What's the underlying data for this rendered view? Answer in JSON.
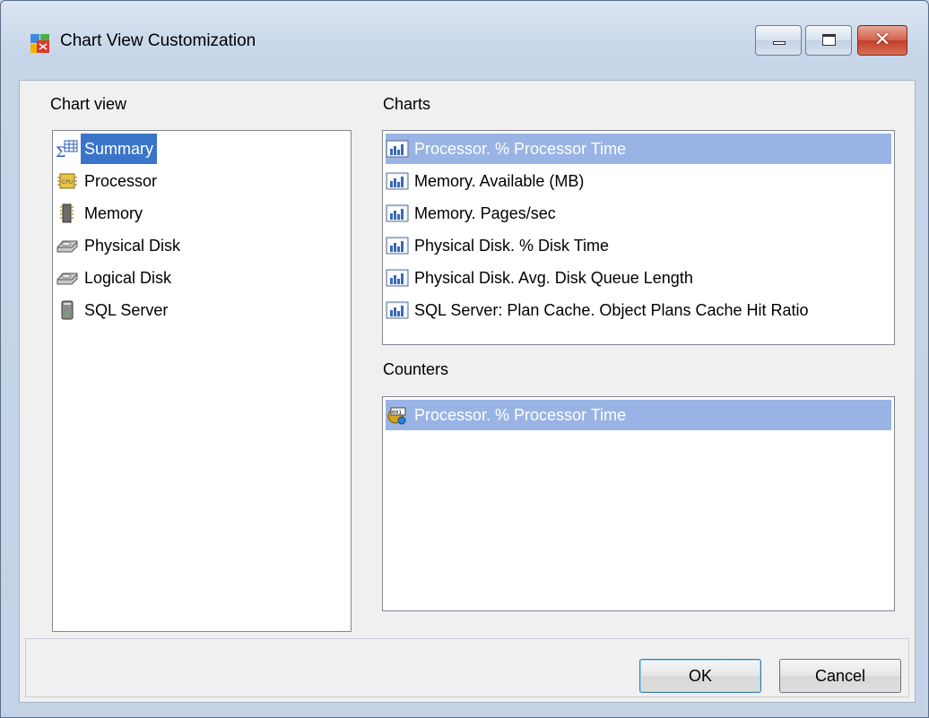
{
  "window": {
    "title": "Chart View Customization"
  },
  "chart_view": {
    "label": "Chart view",
    "items": [
      {
        "label": "Summary",
        "icon": "summary-icon",
        "selected": true
      },
      {
        "label": "Processor",
        "icon": "processor-icon",
        "selected": false
      },
      {
        "label": "Memory",
        "icon": "memory-icon",
        "selected": false
      },
      {
        "label": "Physical Disk",
        "icon": "disk-icon",
        "selected": false
      },
      {
        "label": "Logical Disk",
        "icon": "disk-icon",
        "selected": false
      },
      {
        "label": "SQL Server",
        "icon": "server-icon",
        "selected": false
      }
    ]
  },
  "charts": {
    "label": "Charts",
    "items": [
      {
        "label": "Processor. % Processor Time",
        "icon": "chart-icon",
        "selected": true
      },
      {
        "label": "Memory. Available (MB)",
        "icon": "chart-icon",
        "selected": false
      },
      {
        "label": "Memory. Pages/sec",
        "icon": "chart-icon",
        "selected": false
      },
      {
        "label": "Physical Disk. % Disk Time",
        "icon": "chart-icon",
        "selected": false
      },
      {
        "label": "Physical Disk. Avg. Disk Queue Length",
        "icon": "chart-icon",
        "selected": false
      },
      {
        "label": "SQL Server: Plan Cache. Object Plans Cache Hit Ratio",
        "icon": "chart-icon",
        "selected": false
      }
    ]
  },
  "counters": {
    "label": "Counters",
    "items": [
      {
        "label": "Processor. % Processor Time",
        "icon": "counter-icon",
        "selected": true
      }
    ]
  },
  "buttons": {
    "ok": "OK",
    "cancel": "Cancel"
  },
  "colors": {
    "selection": "#3a75c9",
    "selection_soft": "#99b4e4"
  }
}
